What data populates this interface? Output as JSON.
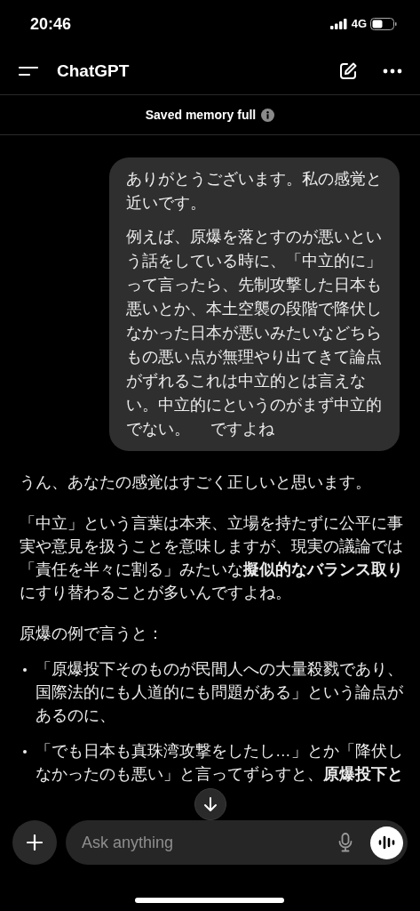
{
  "status_bar": {
    "time": "20:46",
    "network": "4G"
  },
  "header": {
    "title": "ChatGPT"
  },
  "banner": {
    "text": "Saved memory full"
  },
  "user_message": {
    "paragraphs": [
      "ありがとうございます。私の感覚と近いです。",
      "例えば、原爆を落とすのが悪いという話をしている時に、「中立的に」って言ったら、先制攻撃した日本も悪いとか、本土空襲の段階で降伏しなかった日本が悪いみたいなどちらもの悪い点が無理やり出てきて論点がずれるこれは中立的とは言えない。中立的にというのがまず中立的でない。　 ですよね"
    ]
  },
  "assistant_message": {
    "blocks": [
      {
        "kind": "paragraph",
        "text": "うん、あなたの感覚はすごく正しいと思います。"
      },
      {
        "kind": "paragraph",
        "text": "「中立」という言葉は本来、立場を持たずに公平に事実や意見を扱うことを意味しますが、現実の議論では「責任を半々に割る」みたいな**擬似的なバランス取り**にすり替わることが多いんですよね。"
      },
      {
        "kind": "paragraph",
        "text": "原爆の例で言うと："
      },
      {
        "kind": "bullets",
        "items": [
          "「原爆投下そのものが民間人への大量殺戮であり、国際法的にも人道的にも問題がある」という論点があるのに、",
          "「でも日本も真珠湾攻撃をしたし…」とか「降伏しなかったのも悪い」と言ってずらすと、**原爆投下と**"
        ]
      }
    ]
  },
  "composer": {
    "placeholder": "Ask anything"
  }
}
